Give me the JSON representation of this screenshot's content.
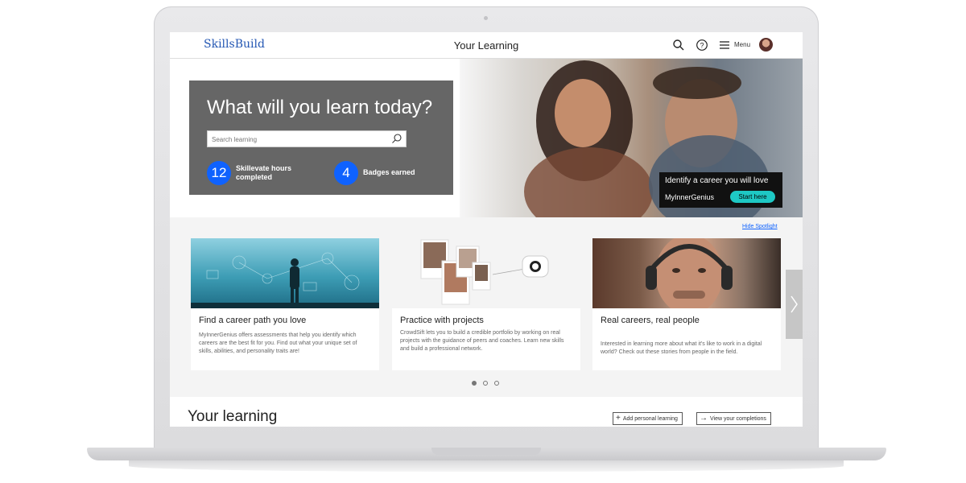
{
  "header": {
    "logo": "SkillsBuild",
    "title": "Your Learning",
    "menu_label": "Menu"
  },
  "hero": {
    "heading": "What will you learn today?",
    "search_placeholder": "Search learning",
    "stats": [
      {
        "value": "12",
        "label_line1": "Skillevate hours",
        "label_line2": "completed"
      },
      {
        "value": "4",
        "label_line1": "Badges earned",
        "label_line2": ""
      }
    ],
    "cta": {
      "text": "Identify a career you will love",
      "brand": "MyInnerGenius",
      "button": "Start here"
    }
  },
  "spotlight": {
    "hide_link": "Hide Spotlight",
    "cards": [
      {
        "title": "Find a career path you love",
        "description": "MyInnerGenius offers assessments that help you identify which careers are the best fit for you. Find out what your unique set of skills, abilities, and personality traits are!"
      },
      {
        "title": "Practice with projects",
        "description": "CrowdSift lets you to build a credible portfolio by working on real projects with the guidance of peers and coaches. Learn new skills and build a professional network."
      },
      {
        "title": "Real careers, real people",
        "description": "Interested in learning more about what it's like to work in a digital world? Check out these stories from people in the field."
      }
    ],
    "active_page": 1,
    "page_count": 3
  },
  "your_learning": {
    "title": "Your learning",
    "add_button": "Add personal learning",
    "view_button": "View your completions"
  },
  "colors": {
    "brand_blue": "#0f62fe",
    "cta_teal": "#1ec8c4",
    "card_gray": "#666666"
  },
  "icons": {
    "search": "search-icon",
    "help": "help-icon",
    "menu": "hamburger-menu-icon",
    "next": "chevron-right-icon",
    "add": "plus-icon",
    "view": "arrow-right-icon"
  }
}
